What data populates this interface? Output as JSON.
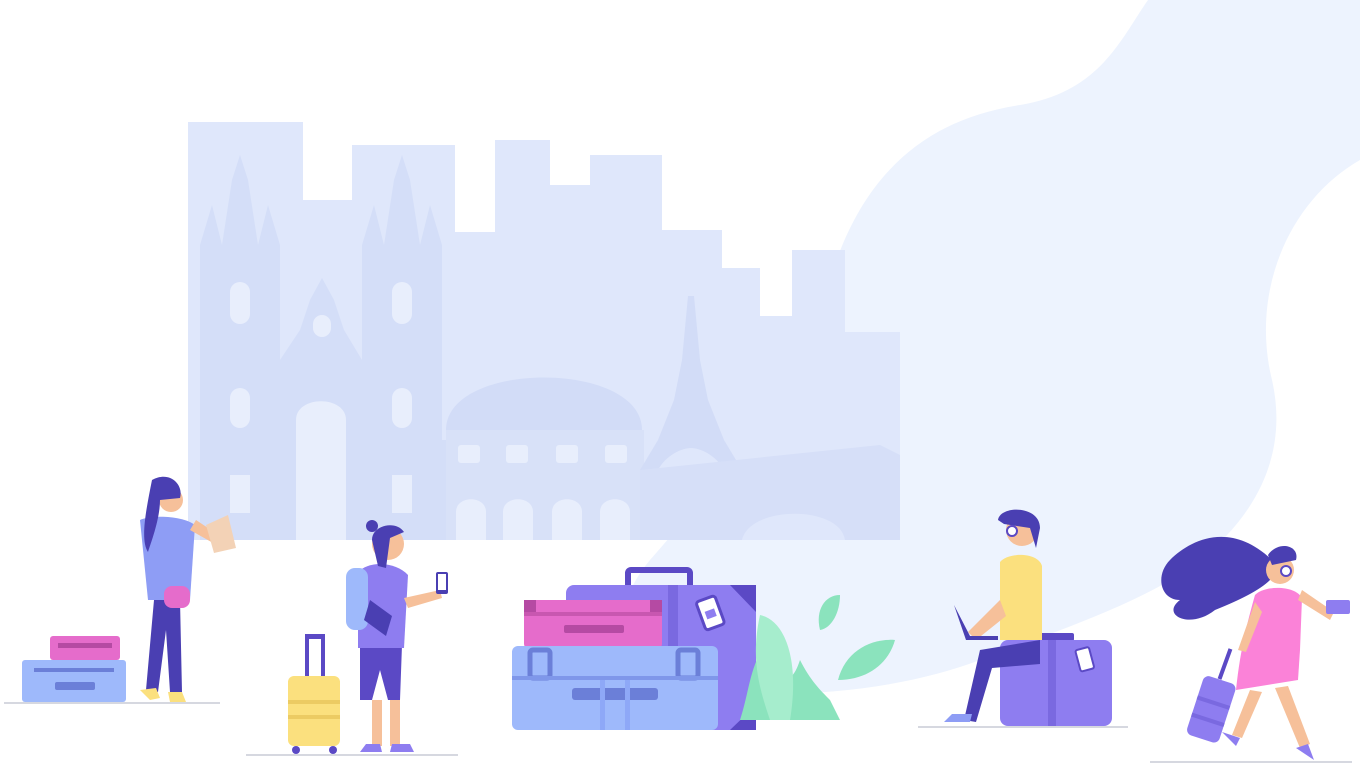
{
  "illustration": {
    "subject": "travel",
    "colors": {
      "background": "#ffffff",
      "blob": "#edf3fe",
      "city": "#dfe7fb",
      "city_detail": "#cfdaf6",
      "purple": "#8e7df0",
      "purple_dark": "#5b49c5",
      "blue_light": "#9eb9fb",
      "pink": "#e56ccb",
      "yellow": "#fbe07e",
      "green": "#8be3bd",
      "skin": "#f6c09a",
      "hair": "#4a3fb2",
      "ground": "#d6d8e0"
    }
  }
}
